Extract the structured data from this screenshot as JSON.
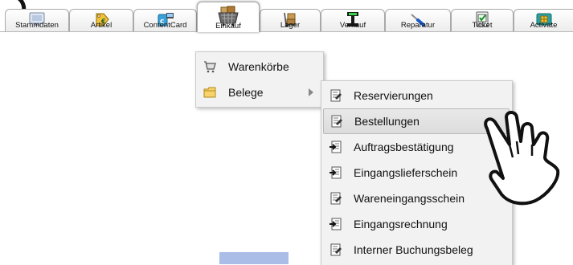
{
  "tabs": [
    {
      "label": "Stammdaten",
      "icon": "screen-icon"
    },
    {
      "label": "Artikel",
      "icon": "price-tag-icon"
    },
    {
      "label": "ContentCard",
      "icon": "content-card-icon"
    },
    {
      "label": "Einkauf",
      "icon": "shopping-basket-icon",
      "active": true
    },
    {
      "label": "Lager",
      "icon": "hand-truck-icon"
    },
    {
      "label": "Verkauf",
      "icon": "cash-register-icon"
    },
    {
      "label": "Reparatur",
      "icon": "screwdriver-icon"
    },
    {
      "label": "Ticket",
      "icon": "checklist-icon"
    },
    {
      "label": "Activate",
      "icon": "sim-card-icon"
    }
  ],
  "menu": {
    "items": [
      {
        "label": "Warenkörbe",
        "icon": "shopping-cart-icon"
      },
      {
        "label": "Belege",
        "icon": "folder-icon",
        "submenu": true
      }
    ]
  },
  "submenu": {
    "items": [
      {
        "label": "Reservierungen",
        "icon": "document-edit-icon"
      },
      {
        "label": "Bestellungen",
        "icon": "document-edit-icon",
        "highlighted": true
      },
      {
        "label": "Auftragsbestätigung",
        "icon": "document-import-icon"
      },
      {
        "label": "Eingangslieferschein",
        "icon": "document-import-icon"
      },
      {
        "label": "Wareneingangsschein",
        "icon": "document-edit-icon"
      },
      {
        "label": "Eingangsrechnung",
        "icon": "document-import-icon"
      },
      {
        "label": "Interner Buchungsbeleg",
        "icon": "document-edit-icon"
      }
    ]
  },
  "colors": {
    "menu_bg": "#f2f2f2",
    "highlight_bg": "#dcdcdc",
    "tab_border": "#a9a9a9",
    "blue_box": "#a9bde6"
  }
}
